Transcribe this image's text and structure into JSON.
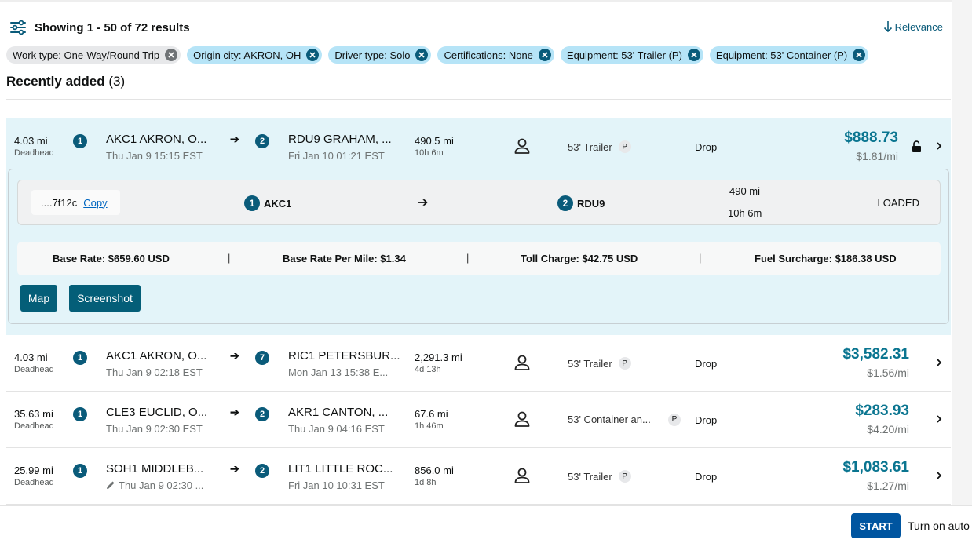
{
  "header": {
    "results_text": "Showing 1 - 50 of 72 results",
    "sort_label": "Relevance",
    "filter_icon": "filter-sliders-icon",
    "sort_icon": "arrow-down-icon"
  },
  "filters": [
    {
      "label": "Work type: One-Way/Round Trip",
      "style": "grey"
    },
    {
      "label": "Origin city: AKRON, OH",
      "style": "blue"
    },
    {
      "label": "Driver type: Solo",
      "style": "blue"
    },
    {
      "label": "Certifications: None",
      "style": "blue"
    },
    {
      "label": "Equipment: 53' Trailer (P)",
      "style": "blue"
    },
    {
      "label": "Equipment: 53' Container (P)",
      "style": "blue"
    }
  ],
  "section": {
    "title": "Recently added",
    "count": "(3)"
  },
  "loads": [
    {
      "deadhead": "4.03 mi",
      "deadhead_label": "Deadhead",
      "origin_stop": "1",
      "origin_name": "AKC1 AKRON, O...",
      "origin_time": "Thu Jan 9 15:15 EST",
      "arrow": "➔",
      "dest_stop": "2",
      "dest_name": "RDU9 GRAHAM, ...",
      "dest_time": "Fri Jan 10 01:21 EST",
      "distance": "490.5 mi",
      "duration": "10h 6m",
      "equipment": "53' Trailer",
      "p_badge": "P",
      "trailer_type": "Drop",
      "price": "$888.73",
      "per_mile": "$1.81/mi",
      "expanded": true,
      "details": {
        "id": "....7f12c",
        "copy_label": "Copy",
        "stop1_num": "1",
        "stop1_code": "AKC1",
        "arrow": "➔",
        "stop2_num": "2",
        "stop2_code": "RDU9",
        "distance": "490 mi",
        "duration": "10h 6m",
        "status": "LOADED",
        "base_rate": "Base Rate: $659.60 USD",
        "base_rate_per_mile": "Base Rate Per Mile: $1.34",
        "toll_charge": "Toll Charge: $42.75 USD",
        "fuel_surcharge": "Fuel Surcharge: $186.38 USD",
        "separator": "|",
        "map_label": "Map",
        "screenshot_label": "Screenshot"
      }
    },
    {
      "deadhead": "4.03 mi",
      "deadhead_label": "Deadhead",
      "origin_stop": "1",
      "origin_name": "AKC1 AKRON, O...",
      "origin_time": "Thu Jan 9 02:18 EST",
      "arrow": "➔",
      "dest_stop": "7",
      "dest_name": "RIC1 PETERSBUR...",
      "dest_time": "Mon Jan 13 15:38 E...",
      "distance": "2,291.3 mi",
      "duration": "4d 13h",
      "equipment": "53' Trailer",
      "p_badge": "P",
      "trailer_type": "Drop",
      "price": "$3,582.31",
      "per_mile": "$1.56/mi"
    },
    {
      "deadhead": "35.63 mi",
      "deadhead_label": "Deadhead",
      "origin_stop": "1",
      "origin_name": "CLE3 EUCLID, O...",
      "origin_time": "Thu Jan 9 02:30 EST",
      "arrow": "➔",
      "dest_stop": "2",
      "dest_name": "AKR1 CANTON, ...",
      "dest_time": "Thu Jan 9 04:16 EST",
      "distance": "67.6 mi",
      "duration": "1h 46m",
      "equipment": "53' Container an...",
      "p_badge": "P",
      "trailer_type": "Drop",
      "price": "$283.93",
      "per_mile": "$4.20/mi"
    },
    {
      "deadhead": "25.99 mi",
      "deadhead_label": "Deadhead",
      "origin_stop": "1",
      "origin_name": "SOH1 MIDDLEB...",
      "origin_time": "Thu Jan 9 02:30 ...",
      "arrow": "➔",
      "dest_stop": "2",
      "dest_name": "LIT1 LITTLE ROC...",
      "dest_time": "Fri Jan 10 10:31 EST",
      "distance": "856.0 mi",
      "duration": "1d 8h",
      "equipment": "53' Trailer",
      "p_badge": "P",
      "trailer_type": "Drop",
      "price": "$1,083.61",
      "per_mile": "$1.27/mi"
    }
  ],
  "footer": {
    "start_label": "START",
    "auto_text": "Turn on auto"
  },
  "colors": {
    "accent": "#0a5b7a",
    "price": "#0a7590",
    "expanded_bg": "#e3f4f9",
    "chip_blue": "#b6e4f7",
    "start_button": "#0055a0"
  }
}
